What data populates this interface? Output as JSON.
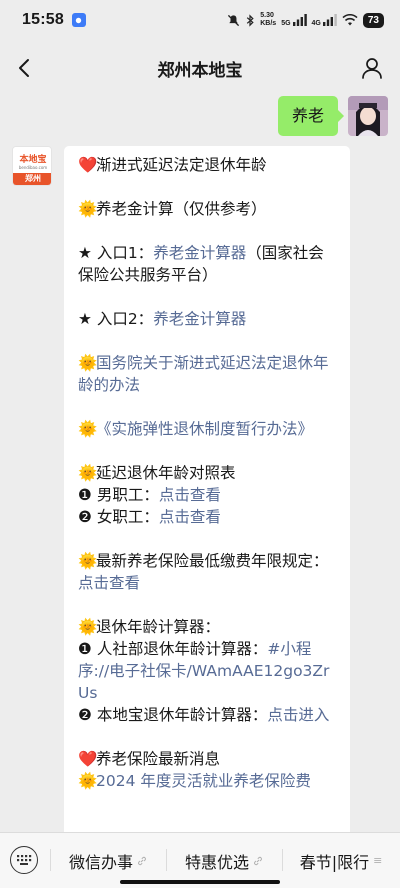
{
  "status_bar": {
    "time": "15:58",
    "speed_value": "5.30",
    "speed_unit": "KB/s",
    "net1": "5G",
    "net2": "4G",
    "battery": "73"
  },
  "nav": {
    "title": "郑州本地宝",
    "back_icon": "chevron-left-icon",
    "profile_icon": "person-icon"
  },
  "user_message": {
    "text": "养老"
  },
  "bot_avatar": {
    "logo_text": "本地宝",
    "logo_domain": "bendibao.com",
    "city": "郑州"
  },
  "bot_message": {
    "heading": "渐进式延迟法定退休年龄",
    "calc_title": "养老金计算（仅供参考）",
    "entry1_prefix": "★ 入口1：",
    "entry1_link": "养老金计算器",
    "entry1_suffix": "（国家社会保险公共服务平台）",
    "entry2_prefix": "★ 入口2：",
    "entry2_link": "养老金计算器",
    "state_council_link": "国务院关于渐进式延迟法定退休年龄的办法",
    "flexible_link": "《实施弹性退休制度暂行办法》",
    "table_title": "延迟退休年龄对照表",
    "male_label": "❶ 男职工：",
    "male_link": "点击查看",
    "female_label": "❷ 女职工：",
    "female_link": "点击查看",
    "min_years_text": "最新养老保险最低缴费年限规定：",
    "min_years_link": "点击查看",
    "retire_calc_title": "退休年龄计算器：",
    "hrss_label": "❶ 人社部退休年龄计算器：",
    "hrss_link": "#小程序://电子社保卡/WAmAAE12go3ZrUs",
    "local_label": "❷ 本地宝退休年龄计算器：",
    "local_link": "点击进入",
    "latest_title": "养老保险最新消息",
    "latest_item": "2024 年度灵活就业养老保险费"
  },
  "bottom_menu": {
    "item1": "微信办事",
    "item2": "特惠优选",
    "item3": "春节|限行",
    "keyboard_icon": "keyboard-icon"
  },
  "colors": {
    "link": "#576b95",
    "user_bubble": "#95ec69",
    "background": "#ededed",
    "brand": "#e8542a"
  }
}
